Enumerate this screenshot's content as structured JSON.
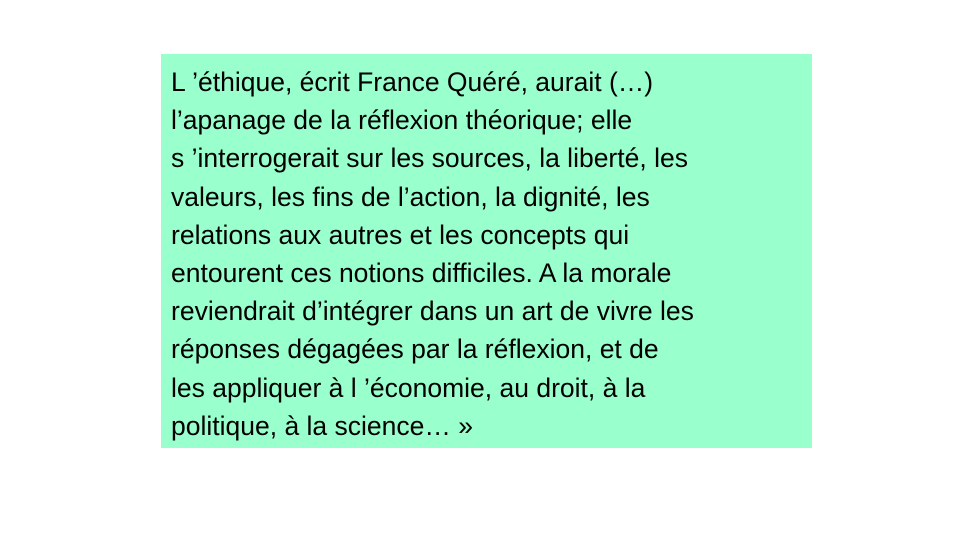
{
  "slide": {
    "background": "#ffffff",
    "quote_box": {
      "background": "#99ffcc",
      "lines": [
        "L ’éthique, écrit France Quéré, aurait (…)",
        "l’apanage de la réflexion théorique; elle",
        "s ’interrogerait sur les sources, la liberté, les",
        "valeurs, les fins de l’action, la dignité, les",
        "relations aux autres et les concepts qui",
        "entourent ces notions difficiles. A la morale",
        "reviendrait d’intégrer dans un art de vivre les",
        "réponses dégagées par la réflexion, et de",
        "les appliquer à l ’économie, au droit, à la",
        "politique, à la science… »"
      ]
    }
  }
}
